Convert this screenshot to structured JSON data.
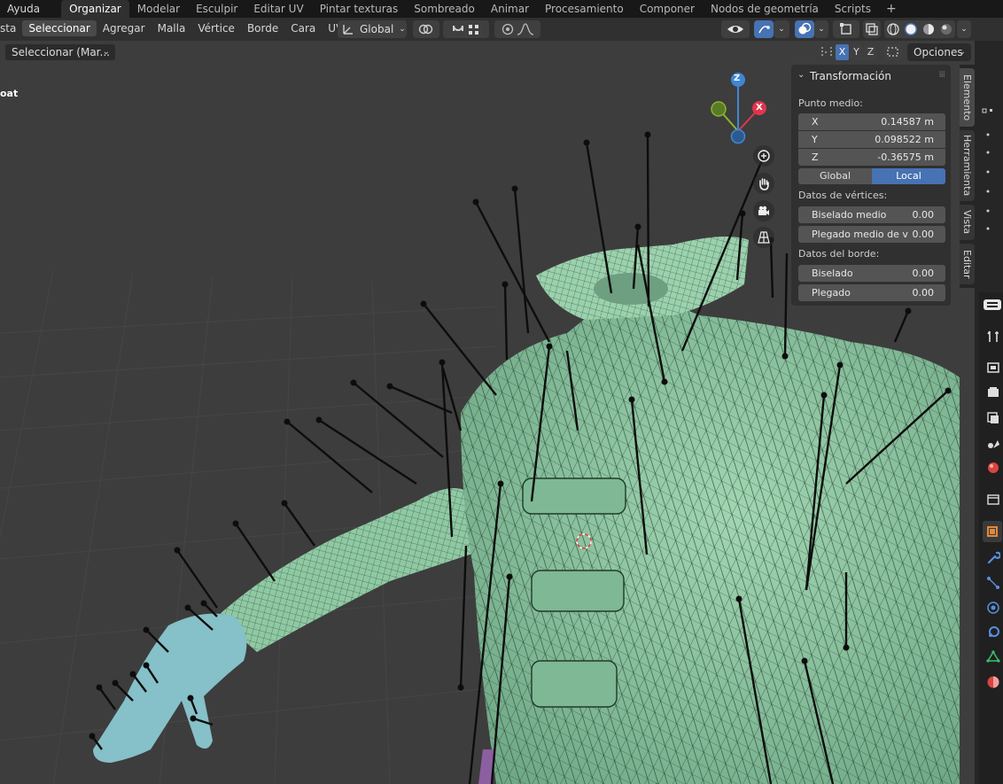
{
  "topbar": {
    "menu": "Ayuda",
    "workspaces": [
      "Organizar",
      "Modelar",
      "Esculpir",
      "Editar UV",
      "Pintar texturas",
      "Sombreado",
      "Animar",
      "Procesamiento",
      "Componer",
      "Nodos de geometría",
      "Scripts"
    ],
    "active_workspace": "Organizar",
    "add_label": "+"
  },
  "header": {
    "menus": [
      "sta",
      "Seleccionar",
      "Agregar",
      "Malla",
      "Vértice",
      "Borde",
      "Cara",
      "UV"
    ],
    "selected_menu": "Seleccionar",
    "orientation": "Global"
  },
  "tool": {
    "select_mode": "Seleccionar (Mar...",
    "options_label": "Opciones",
    "mirror_axes": [
      "X",
      "Y",
      "Z"
    ]
  },
  "viewport": {
    "object_label": "oat",
    "gizmo_axes": {
      "z": "Z",
      "x": "X"
    },
    "colors": {
      "background": "#3d3d3d",
      "mesh": "#8fc9a3",
      "hand": "#86c0c8",
      "x_axis": "#e0364f",
      "y_axis": "#8ab62e",
      "z_axis": "#3f86d4",
      "accent": "#4772b3"
    }
  },
  "npanel": {
    "title": "Transformación",
    "median_label": "Punto medio:",
    "median": [
      {
        "axis": "X",
        "value": "0.14587 m"
      },
      {
        "axis": "Y",
        "value": "0.098522 m"
      },
      {
        "axis": "Z",
        "value": "-0.36575 m"
      }
    ],
    "space_options": [
      "Global",
      "Local"
    ],
    "active_space": "Local",
    "vertex_data_label": "Datos de vértices:",
    "vertex_fields": [
      {
        "label": "Biselado medio",
        "value": "0.00"
      },
      {
        "label": "Plegado medio de v",
        "value": "0.00"
      }
    ],
    "edge_data_label": "Datos del borde:",
    "edge_fields": [
      {
        "label": "Biselado",
        "value": "0.00"
      },
      {
        "label": "Plegado",
        "value": "0.00"
      }
    ]
  },
  "sidebar_tabs": [
    "Elemento",
    "Herramienta",
    "Vista",
    "Editar"
  ],
  "active_tab": "Elemento"
}
